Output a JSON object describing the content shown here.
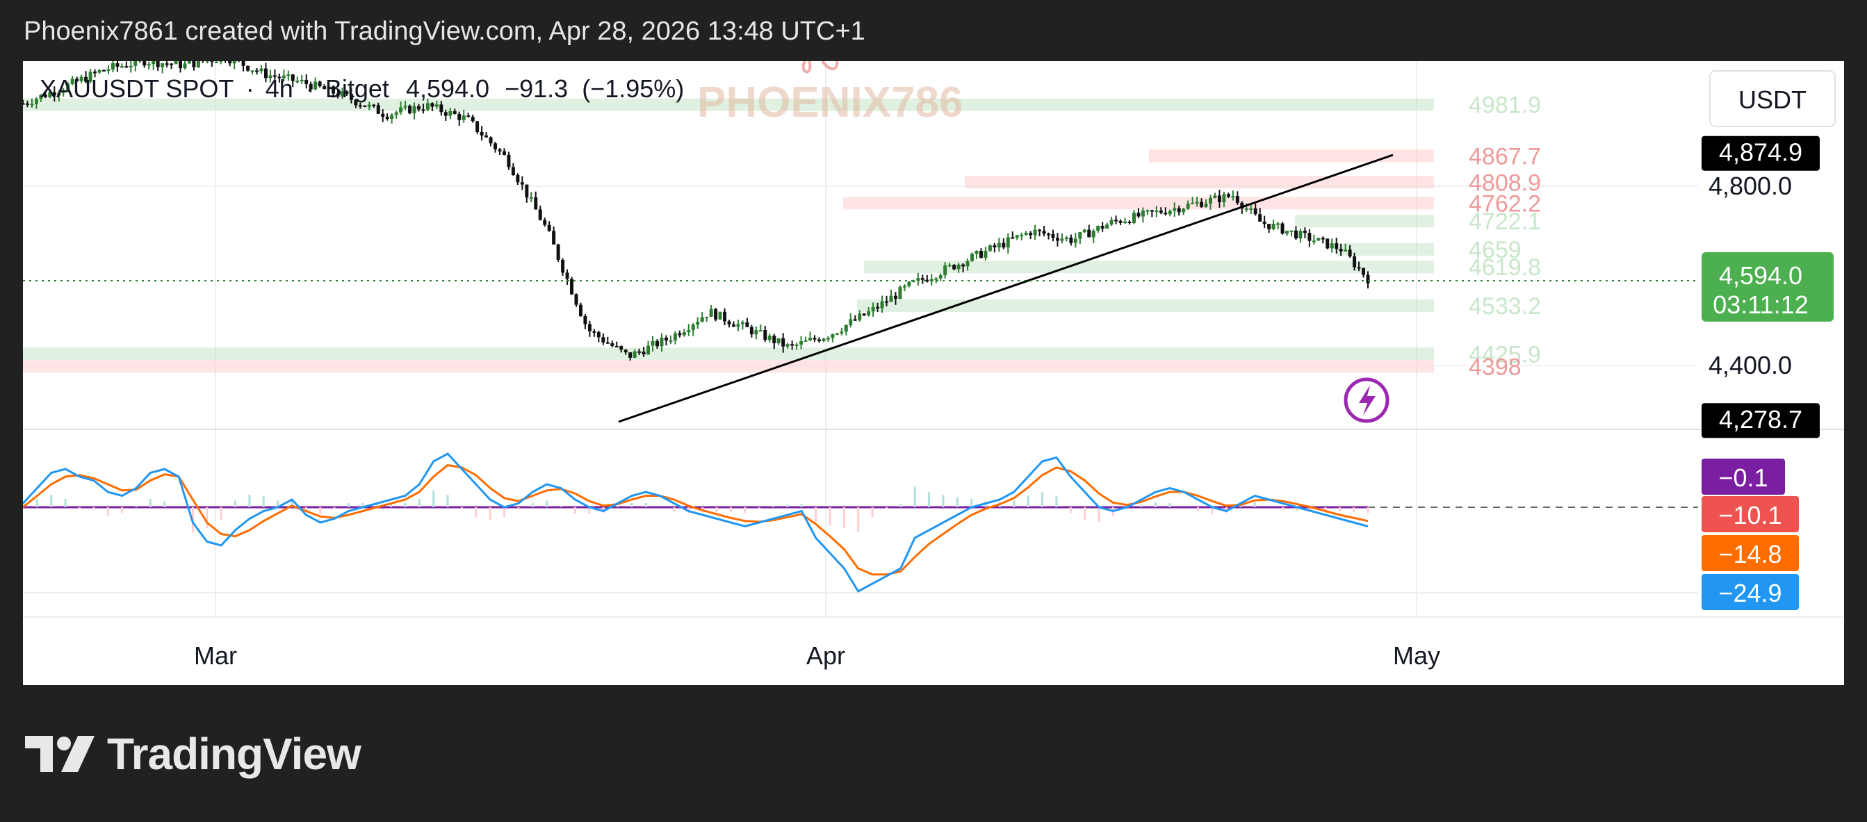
{
  "header": {
    "attribution": "Phoenix7861 created with TradingView.com, Apr 28, 2026 13:48 UTC+1"
  },
  "legend": {
    "symbol": "XAUUSDT SPOT",
    "interval": "4h",
    "exchange": "Bitget",
    "last": "4,594.0",
    "change": "−91.3",
    "change_pct": "(−1.95%)"
  },
  "watermark": {
    "text": "PHOENIX786"
  },
  "currency": "USDT",
  "brand": {
    "name": "TradingView",
    "logo_icon": "tradingview-logo-icon"
  },
  "lightning_icon": "lightning-bolt-icon",
  "colors": {
    "up": "#2e7d32",
    "down": "#111111",
    "macd_line": "#2196f3",
    "signal_line": "#ff6d00",
    "hist_pos": "#b2dfdb",
    "hist_neg": "#ffcdd2",
    "resistance": "#ffcdd2",
    "support": "#c8e6c9",
    "last_price_badge": "#4caf50"
  },
  "chart_data": [
    {
      "type": "candlestick",
      "title": "XAUUSDT SPOT · 4h · Bitget",
      "x_tick_labels": [
        "Mar",
        "Apr",
        "May"
      ],
      "y_tick_labels": [
        "4,800.0",
        "4,400.0"
      ],
      "ylim": [
        4270,
        5050
      ],
      "price_badges": [
        {
          "label": "4,874.9",
          "value": 4874.9,
          "style": "dark"
        },
        {
          "label": "4,594.0",
          "sub": "03:11:12",
          "value": 4594.0,
          "style": "last"
        },
        {
          "label": "4,278.7",
          "value": 4278.7,
          "style": "dark"
        }
      ],
      "levels": [
        {
          "label": "4981.9",
          "value": 4981.9,
          "kind": "support"
        },
        {
          "label": "4867.7",
          "value": 4867.7,
          "kind": "resistance"
        },
        {
          "label": "4808.9",
          "value": 4808.9,
          "kind": "resistance"
        },
        {
          "label": "4762.2",
          "value": 4762.2,
          "kind": "resistance"
        },
        {
          "label": "4722.1",
          "value": 4722.1,
          "kind": "support"
        },
        {
          "label": "4659",
          "value": 4659,
          "kind": "support"
        },
        {
          "label": "4619.8",
          "value": 4619.8,
          "kind": "support"
        },
        {
          "label": "4533.2",
          "value": 4533.2,
          "kind": "support"
        },
        {
          "label": "4425.9",
          "value": 4425.9,
          "kind": "support"
        },
        {
          "label": "4398",
          "value": 4398,
          "kind": "resistance"
        }
      ],
      "series": [
        {
          "name": "Close",
          "t": [
            0.0,
            0.03,
            0.06,
            0.09,
            0.12,
            0.15,
            0.18,
            0.21,
            0.24,
            0.27,
            0.3,
            0.33,
            0.36,
            0.39,
            0.42,
            0.45,
            0.48,
            0.51,
            0.54,
            0.57,
            0.6,
            0.63,
            0.66,
            0.69,
            0.72,
            0.75,
            0.78,
            0.81,
            0.84,
            0.87,
            0.9,
            0.92,
            0.94,
            0.96,
            0.98,
            1.0
          ],
          "values": [
            4985,
            5020,
            5060,
            5080,
            5070,
            5090,
            5050,
            5030,
            5000,
            4960,
            4980,
            4950,
            4860,
            4700,
            4480,
            4420,
            4460,
            4520,
            4480,
            4440,
            4470,
            4520,
            4580,
            4620,
            4660,
            4700,
            4680,
            4720,
            4740,
            4760,
            4780,
            4720,
            4700,
            4680,
            4660,
            4594
          ]
        }
      ]
    },
    {
      "type": "line",
      "title": "MACD",
      "value_badges": [
        {
          "label": "−0.1",
          "value": -0.1,
          "color": "#7b1fa2"
        },
        {
          "label": "−10.1",
          "value": -10.1,
          "color": "#ef5350"
        },
        {
          "label": "−14.8",
          "value": -14.8,
          "color": "#ff6d00"
        },
        {
          "label": "−24.9",
          "value": -24.9,
          "color": "#2196f3"
        }
      ],
      "series": [
        {
          "name": "MACD",
          "values": [
            5,
            25,
            45,
            50,
            40,
            35,
            20,
            15,
            25,
            45,
            50,
            40,
            -20,
            -45,
            -50,
            -30,
            -15,
            -5,
            0,
            10,
            -10,
            -20,
            -15,
            -5,
            0,
            5,
            10,
            15,
            30,
            60,
            70,
            50,
            30,
            10,
            0,
            5,
            20,
            30,
            25,
            10,
            0,
            -5,
            5,
            15,
            20,
            15,
            5,
            -5,
            -10,
            -15,
            -20,
            -25,
            -20,
            -15,
            -10,
            -5,
            -40,
            -60,
            -80,
            -110,
            -100,
            -90,
            -80,
            -40,
            -30,
            -20,
            -10,
            0,
            5,
            10,
            20,
            40,
            60,
            65,
            40,
            20,
            0,
            -5,
            0,
            10,
            20,
            25,
            20,
            10,
            0,
            -5,
            5,
            15,
            10,
            5,
            0,
            -5,
            -10,
            -15,
            -20,
            -25
          ]
        },
        {
          "name": "Signal",
          "values": [
            0,
            15,
            30,
            40,
            42,
            38,
            30,
            22,
            23,
            35,
            43,
            40,
            10,
            -20,
            -35,
            -38,
            -30,
            -18,
            -8,
            2,
            -5,
            -12,
            -14,
            -10,
            -5,
            0,
            5,
            10,
            20,
            40,
            55,
            52,
            42,
            25,
            12,
            8,
            15,
            22,
            24,
            18,
            8,
            2,
            4,
            10,
            15,
            15,
            10,
            2,
            -4,
            -9,
            -14,
            -18,
            -19,
            -17,
            -13,
            -9,
            -22,
            -38,
            -55,
            -80,
            -88,
            -88,
            -84,
            -65,
            -48,
            -35,
            -22,
            -10,
            -2,
            4,
            12,
            26,
            42,
            52,
            47,
            35,
            18,
            6,
            3,
            7,
            14,
            20,
            20,
            15,
            8,
            2,
            3,
            9,
            10,
            8,
            4,
            0,
            -5,
            -10,
            -14,
            -18
          ]
        }
      ]
    }
  ]
}
